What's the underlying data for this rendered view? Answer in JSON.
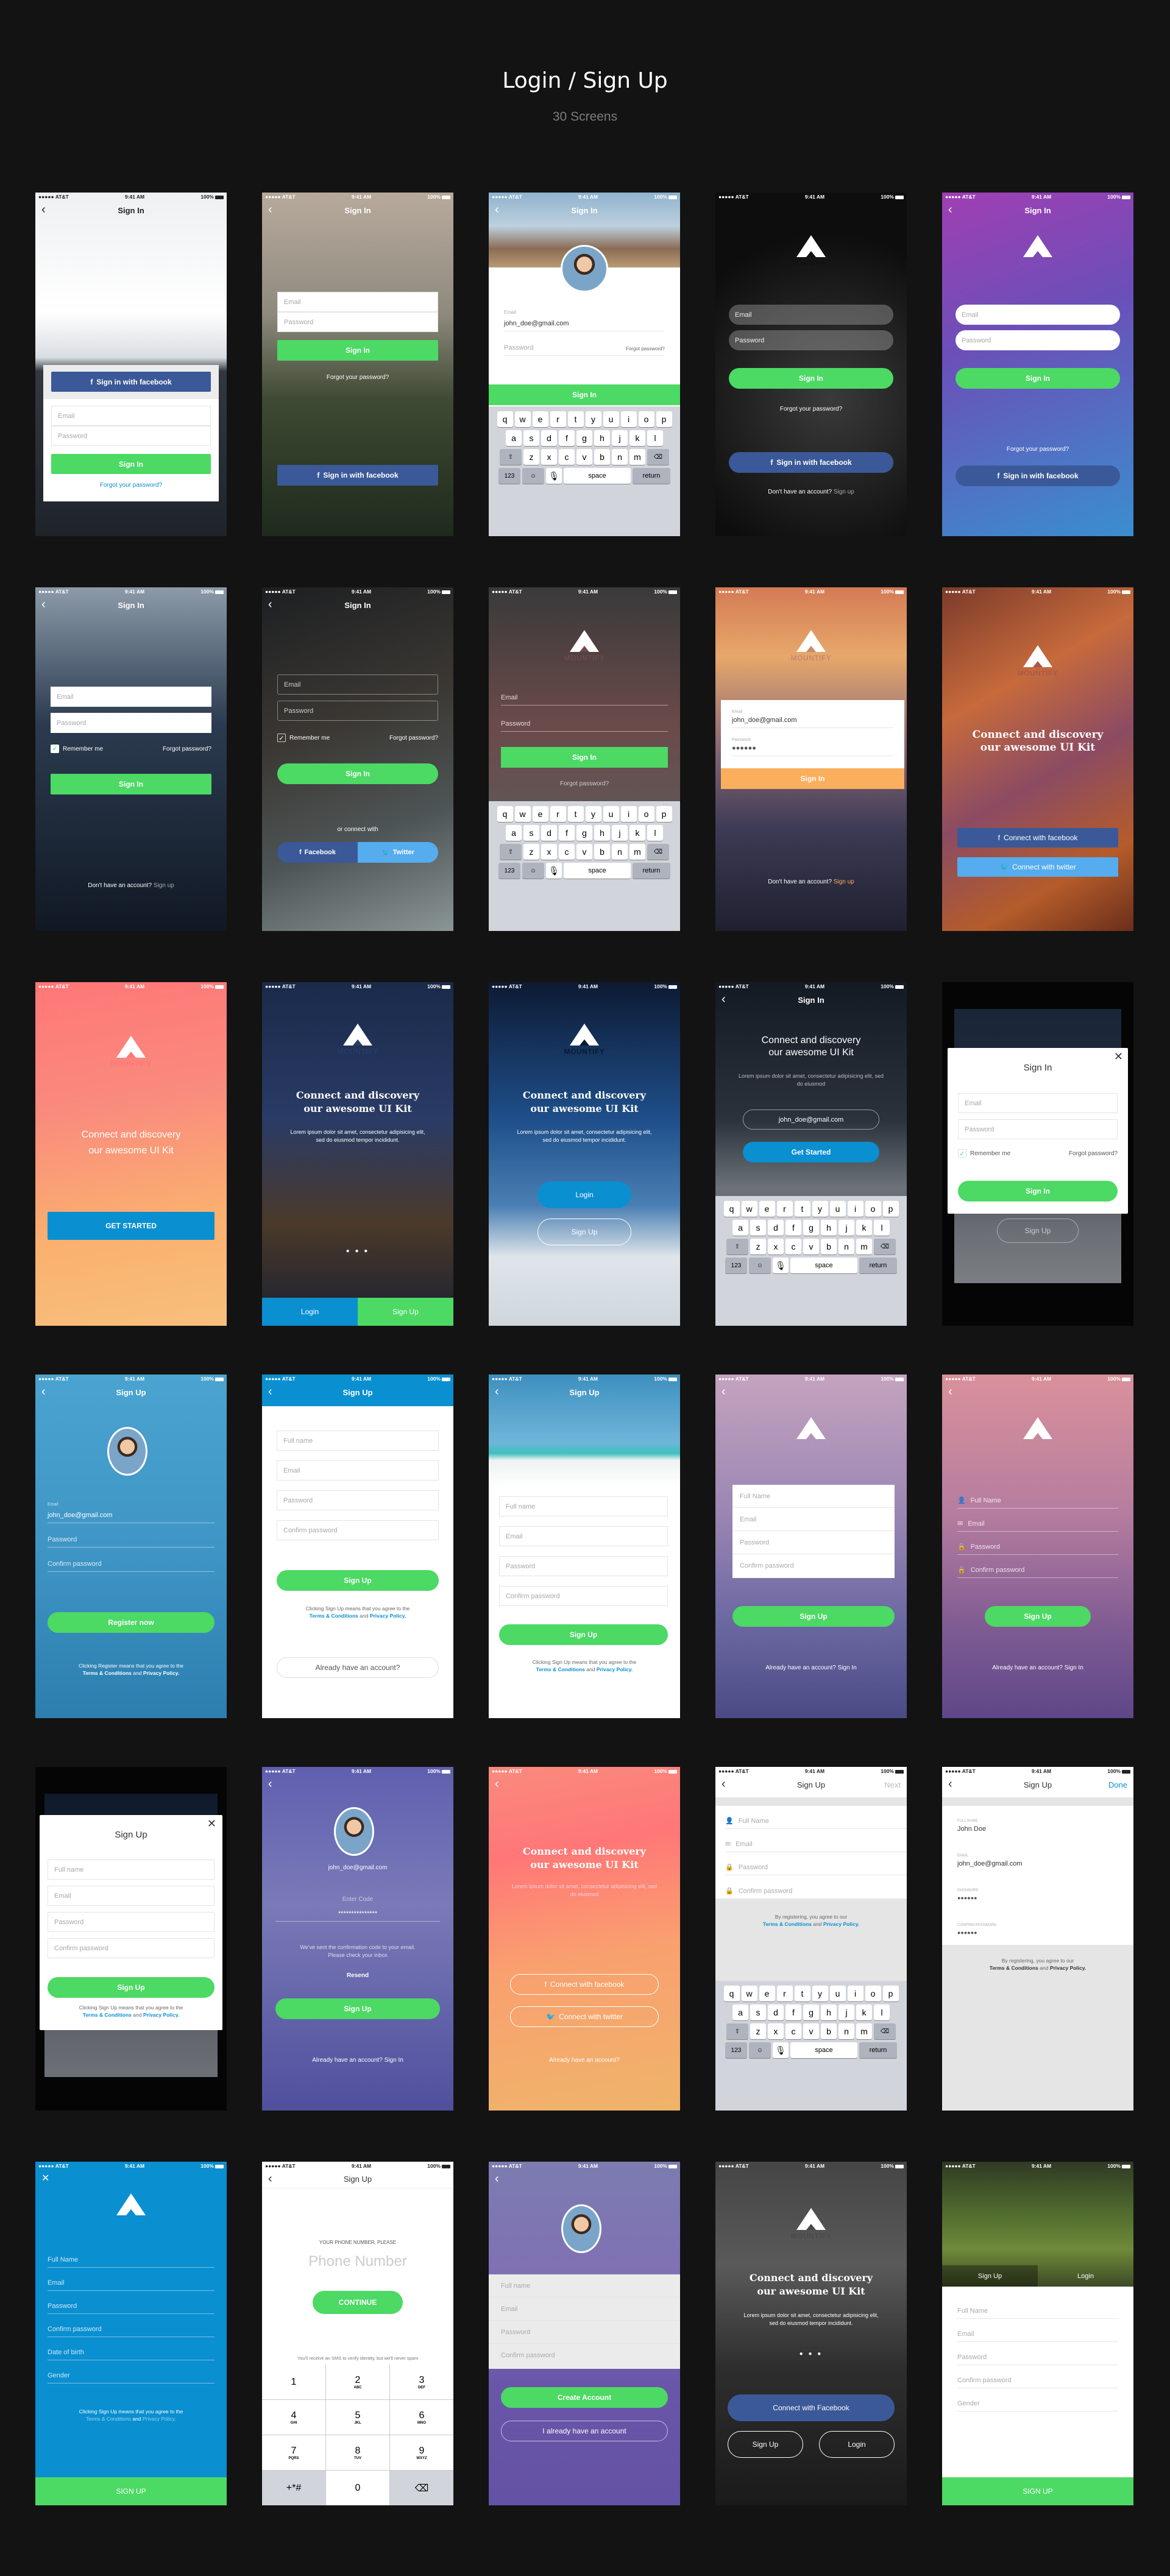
{
  "header": {
    "title": "Login / Sign Up",
    "subtitle": "30 Screens"
  },
  "status": {
    "carrier": "●●●●● AT&T",
    "time": "9:41 AM",
    "battery": "100%"
  },
  "common": {
    "back": "‹",
    "close": "✕",
    "brand": "MOUNTIFY",
    "email": "Email",
    "password": "Password",
    "full_name": "Full name",
    "full_name_cap": "Full Name",
    "confirm_password": "Confirm password",
    "sign_in": "Sign In",
    "sign_up": "Sign Up",
    "forgot_your_password": "Forgot your password?",
    "forgot_password": "Forgot password?",
    "remember_me": "Remember me",
    "dont_have": "Don't have an account?",
    "sign_up_link": "Sign up",
    "already": "Already have an account?",
    "already_sign_in": "Already have an account? Sign In",
    "headline_1": "Connect and discovery",
    "headline_2": "our awesome UI Kit",
    "lorem": "Lorem ipsum dolor sit amet, consectetur adipisicing elit, sed do eiusmod tempor incididunt.",
    "lorem_short": "Lorem ipsum dolor sit amet, consectetur adipisicing elit, sed do eiusmod",
    "email_value": "john_doe@gmail.com",
    "password_dots": "●●●●●●",
    "terms_signup": "Clicking Sign Up means that you agree to the",
    "terms_register": "Clicking Register means that you agree to the",
    "terms_by": "By registering, you agree to our",
    "terms": "Terms & Conditions",
    "and": "and",
    "privacy": "Privacy Policy.",
    "pager": "● ● ●"
  },
  "keyboard": {
    "row1": [
      "q",
      "w",
      "e",
      "r",
      "t",
      "y",
      "u",
      "i",
      "o",
      "p"
    ],
    "row2": [
      "a",
      "s",
      "d",
      "f",
      "g",
      "h",
      "j",
      "k",
      "l"
    ],
    "row3": [
      "z",
      "x",
      "c",
      "v",
      "b",
      "n",
      "m"
    ],
    "shift": "⇧",
    "delete": "⌫",
    "numbers": "123",
    "emoji": "☺",
    "mic": "🎙",
    "space": "space",
    "return": "return"
  },
  "screens": {
    "s1": {
      "fb": "Sign in with facebook"
    },
    "s10": {
      "fb": "Connect with facebook",
      "tw": "Connect with twitter"
    },
    "s7": {
      "or": "or connect with",
      "fb": "Facebook",
      "tw": "Twitter"
    },
    "s11": {
      "cta": "GET STARTED"
    },
    "s12": {
      "login": "Login",
      "signup": "Sign Up"
    },
    "s14": {
      "cta": "Get Started"
    },
    "s16": {
      "cta": "Register now"
    },
    "s22": {
      "enter_code": "Enter Code",
      "code": "***************",
      "msg1": "We've sent the confirmation code to your email.",
      "msg2": "Please check your inbox",
      "resend": "Resend"
    },
    "s23": {
      "already": "Already have an account?"
    },
    "s24": {
      "next": "Next"
    },
    "s25": {
      "done": "Done",
      "l_full": "FULL NAME",
      "v_full": "John Doe",
      "l_email": "EMAIL",
      "l_pw": "PASSWORD",
      "l_cpw": "CONFIRM PASSWORD"
    },
    "s26": {
      "dob": "Date of birth",
      "gender": "Gender",
      "cta": "SIGN UP"
    },
    "s27": {
      "prompt": "YOUR PHONE NUMBER, PLEASE",
      "placeholder": "Phone Number",
      "cta": "CONTINUE",
      "sms": "You'll receive an SMS to verify identity, but we'll never spam",
      "keys": [
        [
          "1",
          ""
        ],
        [
          "2",
          "ABC"
        ],
        [
          "3",
          "DEF"
        ],
        [
          "4",
          "GHI"
        ],
        [
          "5",
          "JKL"
        ],
        [
          "6",
          "MNO"
        ],
        [
          "7",
          "PQRS"
        ],
        [
          "8",
          "TUV"
        ],
        [
          "9",
          "WXYZ"
        ],
        [
          "+*#",
          ""
        ],
        [
          "0",
          ""
        ],
        [
          "⌫",
          ""
        ]
      ]
    },
    "s28": {
      "create": "Create Account",
      "have": "I already have an account"
    },
    "s29": {
      "fb": "Connect with Facebook",
      "signup": "Sign Up",
      "login": "Login"
    },
    "s30": {
      "tab_signup": "Sign Up",
      "tab_login": "Login",
      "gender": "Gender",
      "cta": "SIGN UP"
    }
  },
  "colors": {
    "green": "#4cd964",
    "facebook": "#3b5998",
    "twitter": "#55acee",
    "blue": "#0a8fd1",
    "orange": "#fbae5c"
  }
}
